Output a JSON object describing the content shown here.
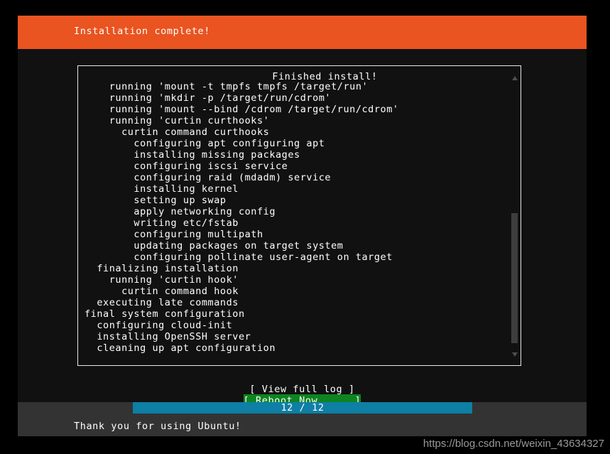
{
  "header": {
    "title": "Installation complete!",
    "accent_color": "#e95420"
  },
  "log_panel": {
    "title": "Finished install!",
    "lines": [
      "    running 'mount -t tmpfs tmpfs /target/run'",
      "    running 'mkdir -p /target/run/cdrom'",
      "    running 'mount --bind /cdrom /target/run/cdrom'",
      "    running 'curtin curthooks'",
      "      curtin command curthooks",
      "        configuring apt configuring apt",
      "        installing missing packages",
      "        configuring iscsi service",
      "        configuring raid (mdadm) service",
      "        installing kernel",
      "        setting up swap",
      "        apply networking config",
      "        writing etc/fstab",
      "        configuring multipath",
      "        updating packages on target system",
      "        configuring pollinate user-agent on target",
      "  finalizing installation",
      "    running 'curtin hook'",
      "      curtin command hook",
      "  executing late commands",
      "final system configuration",
      "  configuring cloud-init",
      "  installing OpenSSH server",
      "  cleaning up apt configuration"
    ],
    "scrollbar": {
      "up_arrow_icon": "triangle-up-icon",
      "down_arrow_icon": "triangle-down-icon"
    }
  },
  "buttons": {
    "view_full_log": "[ View full log ]",
    "reboot_now_prefix": "[ ",
    "reboot_now_accel": "R",
    "reboot_now_rest": "eboot Now      ]",
    "selected_color": "#0e8420"
  },
  "progress": {
    "label": "12 / 12",
    "current": 12,
    "total": 12,
    "bar_color": "#0e7fa5"
  },
  "footer": {
    "message": "Thank you for using Ubuntu!"
  },
  "watermark": {
    "text": "https://blog.csdn.net/weixin_43634327"
  }
}
